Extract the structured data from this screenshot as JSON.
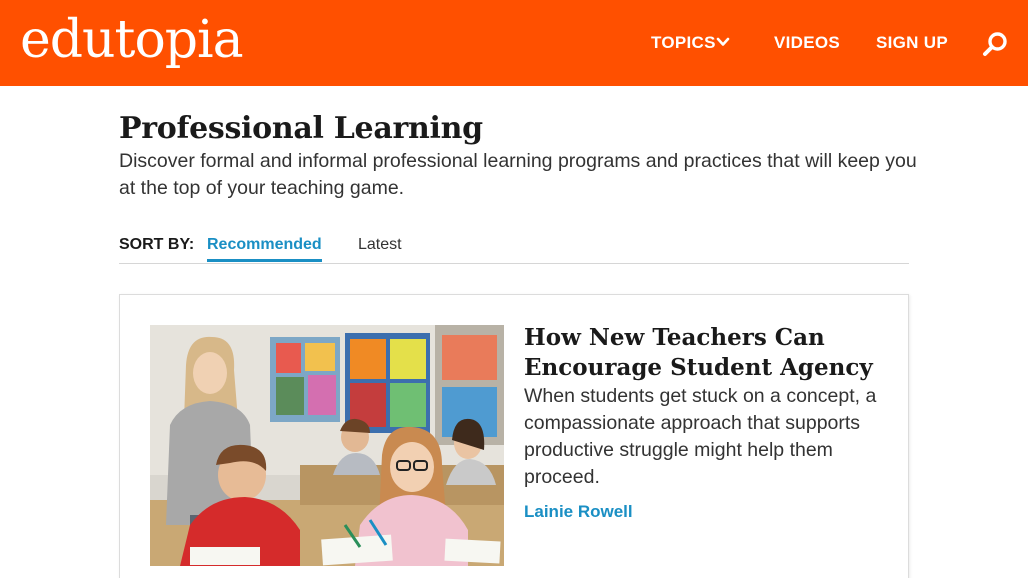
{
  "header": {
    "logo_text": "edutopia",
    "nav": {
      "topics_label": "TOPICS",
      "videos_label": "VIDEOS",
      "signup_label": "SIGN UP"
    },
    "brand_color": "#ff5000"
  },
  "page": {
    "title": "Professional Learning",
    "description": "Discover formal and informal professional learning programs and practices that will keep you at the top of your teaching game."
  },
  "sort": {
    "label": "SORT BY:",
    "options": [
      "Recommended",
      "Latest"
    ],
    "selected": "Recommended",
    "accent_color": "#1a8fc4"
  },
  "articles": [
    {
      "title": "How New Teachers Can Encourage Student Agency",
      "description": "When students get stuck on a concept, a compassionate approach that supports productive struggle might help them proceed.",
      "author": "Lainie Rowell"
    }
  ]
}
